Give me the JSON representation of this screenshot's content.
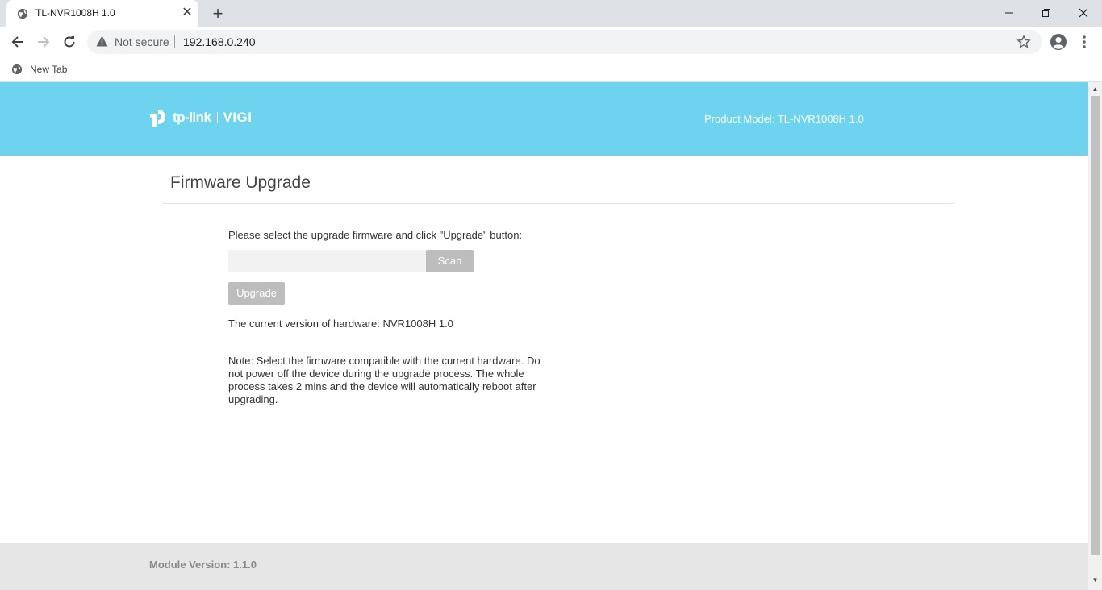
{
  "browser": {
    "tab_title": "TL-NVR1008H 1.0",
    "security_label": "Not secure",
    "url": "192.168.0.240",
    "bookmark_label": "New Tab"
  },
  "header": {
    "logo_brand": "tp-link",
    "logo_product": "VIGI",
    "product_model": "Product Model: TL-NVR1008H 1.0"
  },
  "main": {
    "title": "Firmware Upgrade",
    "instruction": "Please select the upgrade firmware and click \"Upgrade\" button:",
    "file_value": "",
    "scan_label": "Scan",
    "upgrade_label": "Upgrade",
    "hardware_version": "The current version of hardware: NVR1008H 1.0",
    "note": "Note: Select the firmware compatible with the current hardware. Do not power off the device during the upgrade process. The whole process takes 2 mins and the device will automatically reboot after upgrading."
  },
  "footer": {
    "module_version": "Module Version: 1.1.0"
  },
  "colors": {
    "header_bg": "#6dd3ef",
    "button_disabled": "#bdbdbd",
    "footer_bg": "#e6e6e6"
  }
}
